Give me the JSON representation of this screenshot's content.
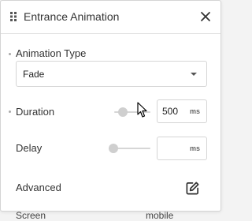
{
  "background_peek": {
    "left_text": "Screen",
    "right_text": "mobile"
  },
  "panel": {
    "title": "Entrance Animation",
    "icons": {
      "handle": "drag-handle-icon",
      "close": "close-icon"
    }
  },
  "animation_type": {
    "label": "Animation Type",
    "selected": "Fade",
    "icon": "chevron-down-icon"
  },
  "duration": {
    "label": "Duration",
    "value": "500",
    "unit": "ms",
    "slider_level": 0.16
  },
  "delay": {
    "label": "Delay",
    "value": "",
    "unit": "ms",
    "slider_level": 0
  },
  "advanced": {
    "label": "Advanced",
    "icon": "edit-icon"
  },
  "colors": {
    "panel_bg": "#ffffff",
    "border": "#d5d5d5",
    "thumb": "#cfcfcf",
    "track": "#d6d6d6"
  }
}
